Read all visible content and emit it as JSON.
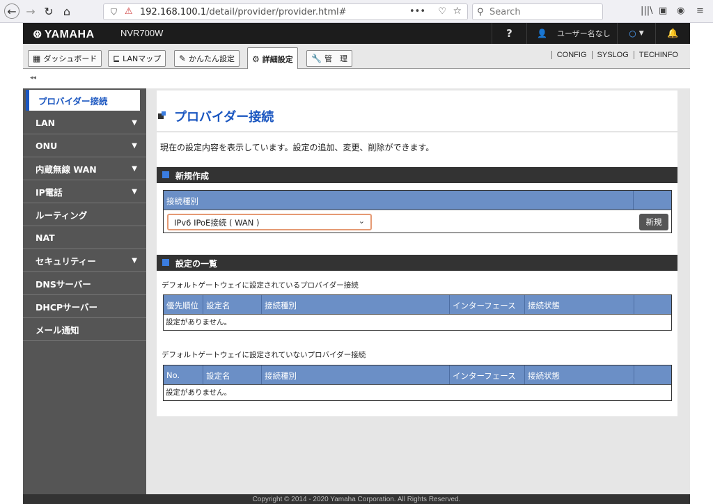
{
  "browser": {
    "url_prefix": "192.168.100.1",
    "url_rest": "/detail/provider/provider.html#",
    "search_placeholder": "Search",
    "dots": "•••"
  },
  "app": {
    "logo": "YAMAHA",
    "model": "NVR700W",
    "help": "?",
    "user": "ユーザー名なし"
  },
  "tabs": [
    {
      "label": "ダッシュボード"
    },
    {
      "label": "LANマップ"
    },
    {
      "label": "かんたん設定"
    },
    {
      "label": "詳細設定"
    },
    {
      "label": "管　理"
    }
  ],
  "toplinks": [
    "CONFIG",
    "SYSLOG",
    "TECHINFO"
  ],
  "collapse": "◂◂",
  "sidebar": [
    {
      "label": "プロバイダー接続",
      "arrow": ""
    },
    {
      "label": "LAN",
      "arrow": "▼"
    },
    {
      "label": "ONU",
      "arrow": "▼"
    },
    {
      "label": "内蔵無線 WAN",
      "arrow": "▼"
    },
    {
      "label": "IP電話",
      "arrow": "▼"
    },
    {
      "label": "ルーティング",
      "arrow": ""
    },
    {
      "label": "NAT",
      "arrow": ""
    },
    {
      "label": "セキュリティー",
      "arrow": "▼"
    },
    {
      "label": "DNSサーバー",
      "arrow": ""
    },
    {
      "label": "DHCPサーバー",
      "arrow": ""
    },
    {
      "label": "メール通知",
      "arrow": ""
    }
  ],
  "main": {
    "title": "プロバイダー接続",
    "description": "現在の設定内容を表示しています。設定の追加、変更、削除ができます。",
    "new_section": {
      "title": "新規作成",
      "column": "接続種別",
      "selected": "IPv6 IPoE接続 ( WAN )",
      "button": "新規"
    },
    "list_section": {
      "title": "設定の一覧",
      "default_label": "デフォルトゲートウェイに設定されているプロバイダー接続",
      "non_default_label": "デフォルトゲートウェイに設定されていないプロバイダー接続",
      "table1_headers": [
        "優先順位",
        "設定名",
        "接続種別",
        "インターフェース",
        "接続状態",
        ""
      ],
      "table2_headers": [
        "No.",
        "設定名",
        "接続種別",
        "インターフェース",
        "接続状態",
        ""
      ],
      "empty": "設定がありません。"
    }
  },
  "footer": "Copyright © 2014 - 2020 Yamaha Corporation. All Rights Reserved."
}
